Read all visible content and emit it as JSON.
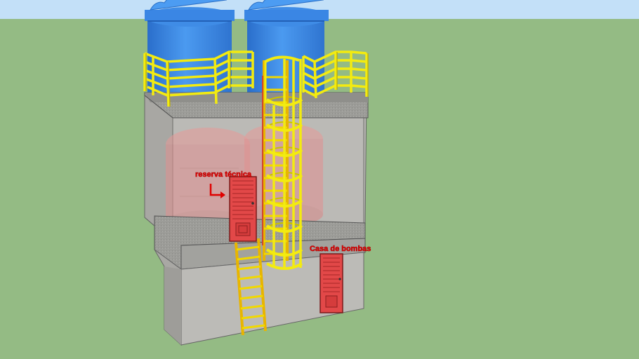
{
  "scene": {
    "labels": {
      "upper_room": "reserva técnica",
      "lower_room": "Casa de bombas"
    },
    "colors": {
      "sky": "#c3e0f8",
      "ground": "#94bb84",
      "concrete": "#b4b4b0",
      "slab": "#9a9a96",
      "tank": "#3a86e4",
      "railing": "#f2ec10",
      "door": "#e04a4a",
      "text_red": "#e00000"
    },
    "icons": {
      "upper_arrow": "down-right-arrow-icon"
    }
  }
}
